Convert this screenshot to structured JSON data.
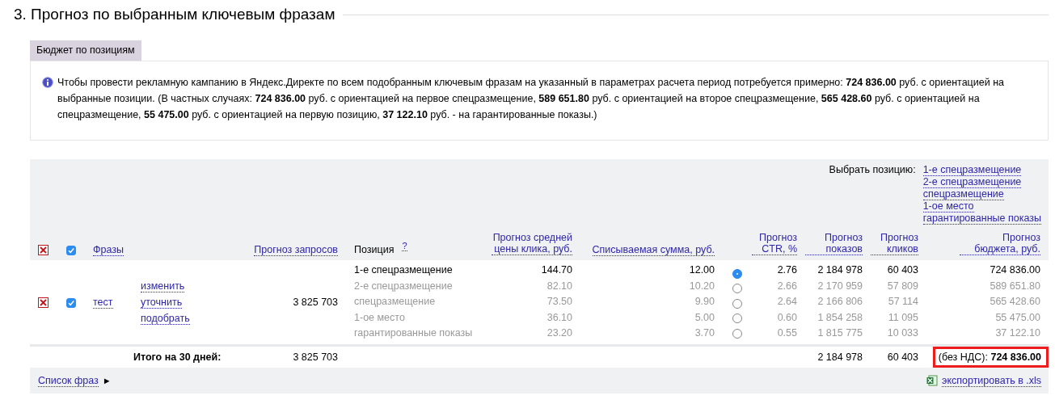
{
  "heading": "3. Прогноз по выбранным ключевым фразам",
  "tabs": [
    {
      "label": "Бюджет по позициям",
      "selected": true
    }
  ],
  "info": "Чтобы провести рекламную кампанию в Яндекс.Директе по всем подобранным ключевым фразам на указанный в параметрах расчета период потребуется примерно: **724 836.00** руб. с ориентацией на выбранные позиции. (В частных случаях: **724 836.00** руб. с ориентацией на первое спецразмещение, **589 651.80** руб. с ориентацией на второе спецразмещение, **565 428.60** руб. с ориентацией на спецразмещение, **55 475.00** руб. с ориентацией на первую позицию, **37 122.10** руб. - на гарантированные показы.)",
  "position_picker": {
    "label": "Выбрать позицию:",
    "links": [
      "1-е спецразмещение",
      "2-е спецразмещение",
      "спецразмещение",
      "1-ое место",
      "гарантированные показы"
    ]
  },
  "table": {
    "select_all": {
      "checked": true
    },
    "columns": [
      {
        "label": "Фразы",
        "kind": "link"
      },
      {
        "label": "Прогноз запросов",
        "kind": "link"
      },
      {
        "label": "Позиция",
        "kind": "text",
        "help": "?"
      },
      {
        "label": "Прогноз средней цены клика, руб.",
        "kind": "link"
      },
      {
        "label": "Списываемая сумма, руб.",
        "kind": "link"
      },
      {
        "label": "Прогноз CTR, %",
        "kind": "link"
      },
      {
        "label": "Прогноз показов",
        "kind": "link"
      },
      {
        "label": "Прогноз кликов",
        "kind": "link"
      },
      {
        "label": "Прогноз бюджета, руб.",
        "kind": "link"
      }
    ],
    "rows": [
      {
        "phrase": "тест",
        "checked": true,
        "actions": [
          "изменить",
          "уточнить",
          "подобрать"
        ],
        "requests": "3 825 703",
        "positions": [
          {
            "name": "1-е спецразмещение",
            "price": "144.70",
            "charge": "12.00",
            "selected": true,
            "ctr": "2.76",
            "shows": "2 184 978",
            "clicks": "60 403",
            "budget": "724 836.00"
          },
          {
            "name": "2-е спецразмещение",
            "price": "82.10",
            "charge": "10.20",
            "selected": false,
            "ctr": "2.66",
            "shows": "2 170 959",
            "clicks": "57 809",
            "budget": "589 651.80"
          },
          {
            "name": "спецразмещение",
            "price": "73.50",
            "charge": "9.90",
            "selected": false,
            "ctr": "2.64",
            "shows": "2 166 806",
            "clicks": "57 114",
            "budget": "565 428.60"
          },
          {
            "name": "1-ое место",
            "price": "36.10",
            "charge": "5.00",
            "selected": false,
            "ctr": "0.60",
            "shows": "1 854 258",
            "clicks": "11 095",
            "budget": "55 475.00"
          },
          {
            "name": "гарантированные показы",
            "price": "23.20",
            "charge": "3.70",
            "selected": false,
            "ctr": "0.55",
            "shows": "1 815 775",
            "clicks": "10 033",
            "budget": "37 122.10"
          }
        ]
      }
    ],
    "total": {
      "label": "Итого на 30 дней:",
      "requests": "3 825 703",
      "shows": "2 184 978",
      "clicks": "60 403",
      "budget": "(без НДС): **724 836.00**",
      "highlighted": true
    }
  },
  "footer": {
    "phrase_list": "Список фраз",
    "arrow": "►",
    "export": "экспортировать в .xls"
  }
}
